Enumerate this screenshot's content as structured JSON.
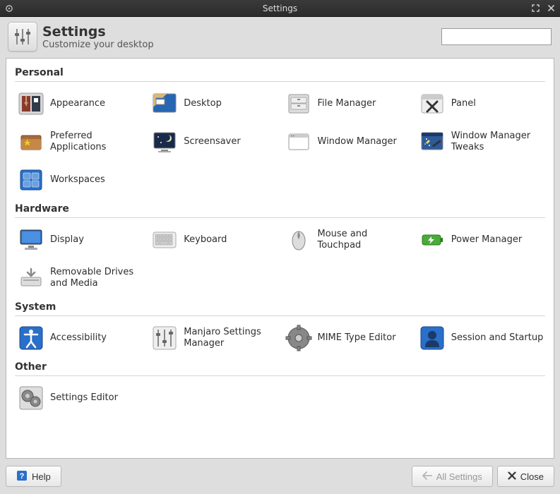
{
  "window": {
    "title": "Settings"
  },
  "header": {
    "title": "Settings",
    "subtitle": "Customize your desktop",
    "search_value": "",
    "search_placeholder": ""
  },
  "categories": [
    {
      "title": "Personal",
      "items": [
        {
          "label": "Appearance",
          "icon": "appearance"
        },
        {
          "label": "Desktop",
          "icon": "desktop"
        },
        {
          "label": "File Manager",
          "icon": "file-manager"
        },
        {
          "label": "Panel",
          "icon": "panel"
        },
        {
          "label": "Preferred Applications",
          "icon": "preferred-apps"
        },
        {
          "label": "Screensaver",
          "icon": "screensaver"
        },
        {
          "label": "Window Manager",
          "icon": "window-manager"
        },
        {
          "label": "Window Manager Tweaks",
          "icon": "wm-tweaks"
        },
        {
          "label": "Workspaces",
          "icon": "workspaces"
        }
      ]
    },
    {
      "title": "Hardware",
      "items": [
        {
          "label": "Display",
          "icon": "display"
        },
        {
          "label": "Keyboard",
          "icon": "keyboard"
        },
        {
          "label": "Mouse and Touchpad",
          "icon": "mouse"
        },
        {
          "label": "Power Manager",
          "icon": "power"
        },
        {
          "label": "Removable Drives and Media",
          "icon": "removable"
        }
      ]
    },
    {
      "title": "System",
      "items": [
        {
          "label": "Accessibility",
          "icon": "accessibility"
        },
        {
          "label": "Manjaro Settings Manager",
          "icon": "manjaro-settings"
        },
        {
          "label": "MIME Type Editor",
          "icon": "mime"
        },
        {
          "label": "Session and Startup",
          "icon": "session"
        }
      ]
    },
    {
      "title": "Other",
      "items": [
        {
          "label": "Settings Editor",
          "icon": "settings-editor"
        }
      ]
    }
  ],
  "footer": {
    "help": "Help",
    "all_settings": "All Settings",
    "close": "Close"
  }
}
